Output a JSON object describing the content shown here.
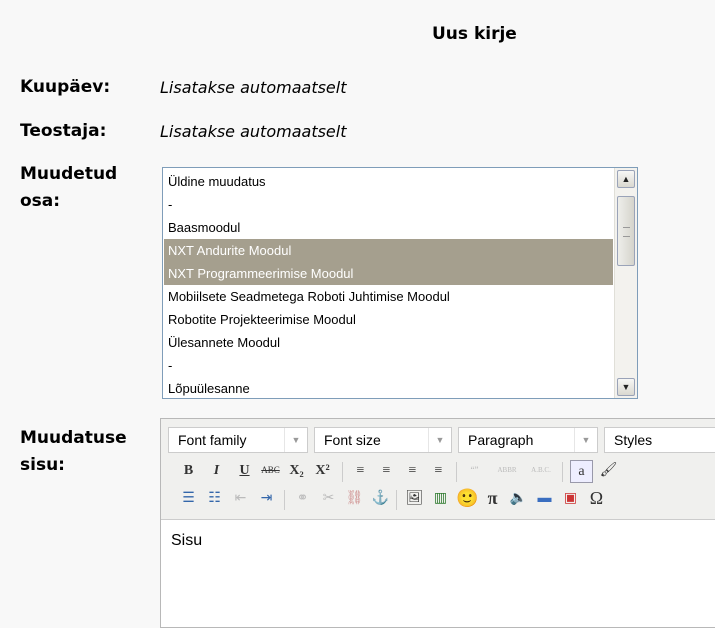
{
  "form": {
    "title": "Uus kirje",
    "date_label": "Kuupäev:",
    "date_value": "Lisatakse automaatselt",
    "author_label": "Teostaja:",
    "author_value": "Lisatakse automaatselt",
    "part_label_1": "Muudetud",
    "part_label_2": "osa:",
    "content_label_1": "Muudatuse",
    "content_label_2": "sisu:"
  },
  "listbox": {
    "options": [
      {
        "label": "Üldine muudatus",
        "selected": false
      },
      {
        "label": "-",
        "selected": false
      },
      {
        "label": "Baasmoodul",
        "selected": false
      },
      {
        "label": "NXT Andurite Moodul",
        "selected": true
      },
      {
        "label": "NXT Programmeerimise Moodul",
        "selected": true
      },
      {
        "label": "Mobiilsete Seadmetega Roboti Juhtimise Moodul",
        "selected": false
      },
      {
        "label": "Robotite Projekteerimise Moodul",
        "selected": false
      },
      {
        "label": "Ülesannete Moodul",
        "selected": false
      },
      {
        "label": "-",
        "selected": false
      },
      {
        "label": "Lõpuülesanne",
        "selected": false
      }
    ]
  },
  "editor": {
    "font_family": "Font family",
    "font_size": "Font size",
    "format": "Paragraph",
    "styles": "Styles",
    "toolbar2": [
      "B",
      "I",
      "U",
      "ABC",
      "X₂",
      "X²",
      "≡",
      "≡",
      "≡",
      "≡",
      "“”",
      "ABBR",
      "A.B.C.",
      "a",
      "🖌"
    ],
    "toolbar3": [
      "☰",
      "☷",
      "⇤",
      "⇥",
      "⚭",
      "✂",
      "⛓",
      "⚓",
      "🖼",
      "▥",
      "🙂",
      "π",
      "🔈",
      "▬",
      "▣",
      "Ω"
    ],
    "content": "Sisu"
  },
  "colors": {
    "selection": "#a59f8e",
    "listbox_border": "#7f9db9"
  }
}
